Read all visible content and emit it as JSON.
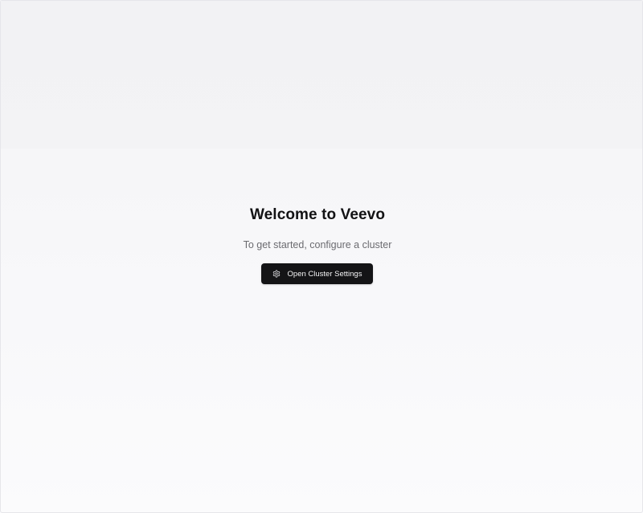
{
  "welcome": {
    "title": "Welcome to Veevo",
    "subtitle": "To get started, configure a cluster",
    "button_label": "Open Cluster Settings",
    "button_icon": "gear-icon"
  },
  "colors": {
    "background": "#f6f6f8",
    "button_background": "#141416",
    "button_text": "#f4f4f5",
    "title_text": "#121214",
    "subtitle_text": "#6b6b70"
  }
}
